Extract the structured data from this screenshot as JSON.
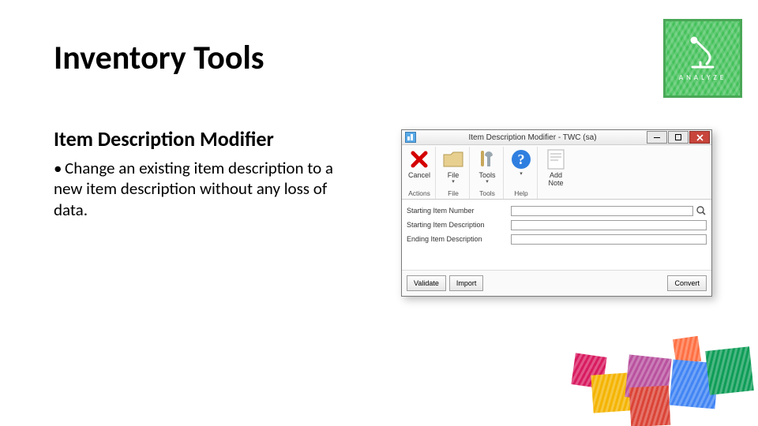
{
  "page": {
    "title": "Inventory Tools",
    "subtitle": "Item Description Modifier",
    "bullet": "Change an existing item description to a new item description without any loss of data."
  },
  "logo": {
    "caption": "ANALYZE"
  },
  "app": {
    "title": "Item Description Modifier  -  TWC (sa)",
    "ribbon": {
      "cancel": {
        "label": "Cancel",
        "group": "Actions"
      },
      "file": {
        "label": "File",
        "group": "File"
      },
      "tools": {
        "label": "Tools",
        "group": "Tools"
      },
      "help": {
        "label": "",
        "group": "Help"
      },
      "addnote": {
        "label": "Add Note"
      }
    },
    "form": {
      "starting_item_number": {
        "label": "Starting Item Number",
        "value": ""
      },
      "starting_item_description": {
        "label": "Starting Item Description",
        "value": ""
      },
      "ending_item_description": {
        "label": "Ending Item Description",
        "value": ""
      }
    },
    "buttons": {
      "validate": "Validate",
      "import": "Import",
      "convert": "Convert"
    }
  }
}
